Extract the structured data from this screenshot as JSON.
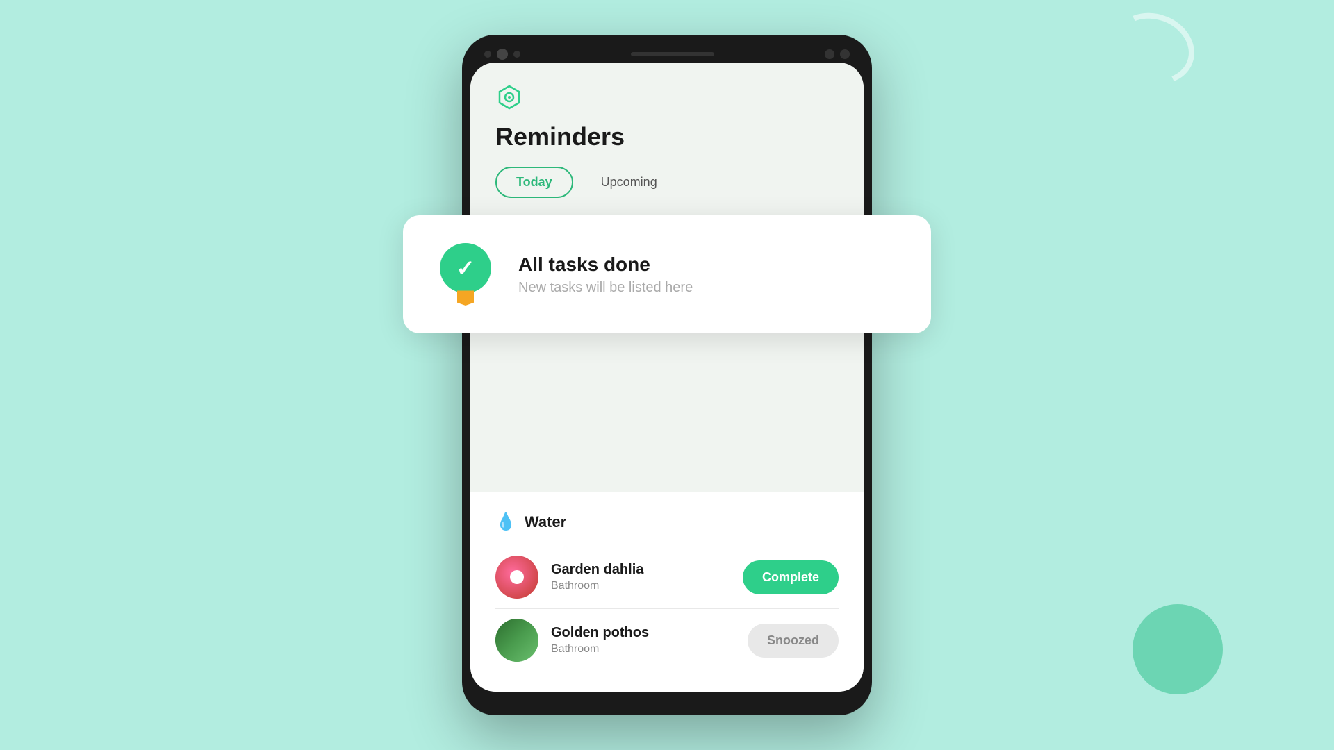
{
  "background": {
    "color": "#b2ede0"
  },
  "app": {
    "icon": "◎",
    "title": "Reminders",
    "tabs": [
      {
        "id": "today",
        "label": "Today",
        "active": true
      },
      {
        "id": "upcoming",
        "label": "Upcoming",
        "active": false
      }
    ]
  },
  "all_tasks_card": {
    "title": "All tasks done",
    "subtitle": "New tasks will be listed here",
    "badge_color": "#2ecf8a",
    "ribbon_color": "#f5a623"
  },
  "water_section": {
    "title": "Water",
    "icon": "💧",
    "plants": [
      {
        "id": "garden-dahlia",
        "name": "Garden dahlia",
        "location": "Bathroom",
        "action_label": "Complete",
        "action_type": "complete"
      },
      {
        "id": "golden-pothos",
        "name": "Golden pothos",
        "location": "Bathroom",
        "action_label": "Snoozed",
        "action_type": "snoozed"
      }
    ]
  }
}
